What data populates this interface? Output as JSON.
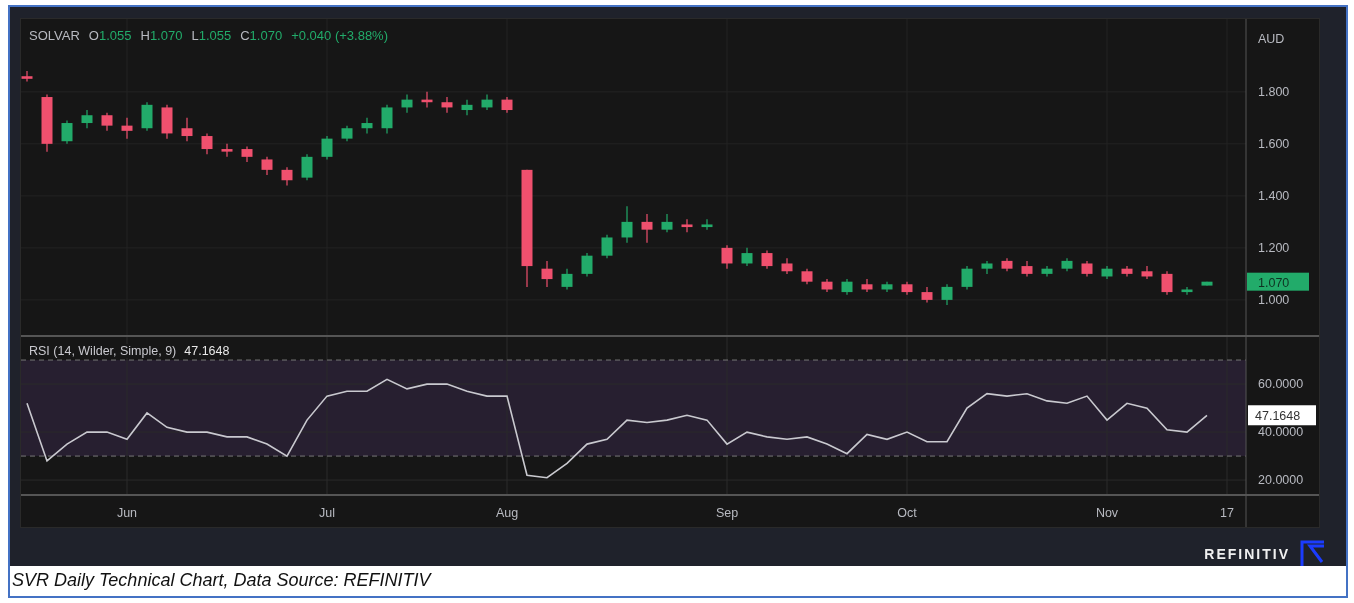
{
  "legend": {
    "symbol": "SOLVAR",
    "items": [
      {
        "label": "O",
        "value": "1.055"
      },
      {
        "label": "H",
        "value": "1.070"
      },
      {
        "label": "L",
        "value": "1.055"
      },
      {
        "label": "C",
        "value": "1.070"
      }
    ],
    "change": "+0.040 (+3.88%)"
  },
  "price_pane": {
    "currency": "AUD",
    "last_price": "1.070",
    "chart_data": {
      "type": "candlestick",
      "grid": true,
      "categories": [
        null,
        null,
        null,
        null,
        null,
        null,
        null,
        null,
        null,
        null,
        null,
        null,
        null,
        null,
        null,
        null,
        null,
        null,
        null,
        null,
        null,
        null,
        null,
        null,
        null,
        null,
        null,
        null,
        null,
        null,
        null,
        null,
        null,
        null,
        null,
        null,
        null,
        null,
        null,
        null,
        null,
        null,
        null,
        null,
        null,
        null,
        null,
        null,
        null,
        null,
        null,
        null,
        null,
        null,
        null,
        null,
        null,
        null,
        null,
        null,
        null
      ],
      "ohlc": [
        [
          1.86,
          1.88,
          1.84,
          1.85
        ],
        [
          1.78,
          1.79,
          1.57,
          1.6
        ],
        [
          1.61,
          1.69,
          1.6,
          1.68
        ],
        [
          1.68,
          1.73,
          1.66,
          1.71
        ],
        [
          1.71,
          1.72,
          1.65,
          1.67
        ],
        [
          1.67,
          1.7,
          1.62,
          1.65
        ],
        [
          1.66,
          1.76,
          1.65,
          1.75
        ],
        [
          1.74,
          1.75,
          1.62,
          1.64
        ],
        [
          1.66,
          1.7,
          1.61,
          1.63
        ],
        [
          1.63,
          1.64,
          1.56,
          1.58
        ],
        [
          1.58,
          1.6,
          1.55,
          1.57
        ],
        [
          1.58,
          1.59,
          1.53,
          1.55
        ],
        [
          1.54,
          1.55,
          1.48,
          1.5
        ],
        [
          1.5,
          1.51,
          1.44,
          1.46
        ],
        [
          1.47,
          1.56,
          1.46,
          1.55
        ],
        [
          1.55,
          1.63,
          1.54,
          1.62
        ],
        [
          1.62,
          1.67,
          1.61,
          1.66
        ],
        [
          1.66,
          1.7,
          1.64,
          1.68
        ],
        [
          1.66,
          1.75,
          1.64,
          1.74
        ],
        [
          1.74,
          1.79,
          1.72,
          1.77
        ],
        [
          1.77,
          1.8,
          1.74,
          1.76
        ],
        [
          1.76,
          1.78,
          1.72,
          1.74
        ],
        [
          1.73,
          1.77,
          1.71,
          1.75
        ],
        [
          1.74,
          1.79,
          1.73,
          1.77
        ],
        [
          1.77,
          1.78,
          1.72,
          1.73
        ],
        [
          1.5,
          1.5,
          1.05,
          1.13
        ],
        [
          1.12,
          1.15,
          1.05,
          1.08
        ],
        [
          1.05,
          1.12,
          1.04,
          1.1
        ],
        [
          1.1,
          1.18,
          1.09,
          1.17
        ],
        [
          1.17,
          1.25,
          1.16,
          1.24
        ],
        [
          1.24,
          1.36,
          1.22,
          1.3
        ],
        [
          1.3,
          1.33,
          1.22,
          1.27
        ],
        [
          1.27,
          1.33,
          1.26,
          1.3
        ],
        [
          1.29,
          1.31,
          1.26,
          1.28
        ],
        [
          1.28,
          1.31,
          1.27,
          1.29
        ],
        [
          1.2,
          1.21,
          1.12,
          1.14
        ],
        [
          1.14,
          1.2,
          1.13,
          1.18
        ],
        [
          1.18,
          1.19,
          1.12,
          1.13
        ],
        [
          1.14,
          1.16,
          1.1,
          1.11
        ],
        [
          1.11,
          1.12,
          1.06,
          1.07
        ],
        [
          1.07,
          1.08,
          1.03,
          1.04
        ],
        [
          1.03,
          1.08,
          1.02,
          1.07
        ],
        [
          1.06,
          1.08,
          1.03,
          1.04
        ],
        [
          1.04,
          1.07,
          1.03,
          1.06
        ],
        [
          1.06,
          1.07,
          1.02,
          1.03
        ],
        [
          1.03,
          1.05,
          0.99,
          1.0
        ],
        [
          1.0,
          1.06,
          0.98,
          1.05
        ],
        [
          1.05,
          1.13,
          1.04,
          1.12
        ],
        [
          1.12,
          1.15,
          1.1,
          1.14
        ],
        [
          1.15,
          1.16,
          1.11,
          1.12
        ],
        [
          1.13,
          1.15,
          1.09,
          1.1
        ],
        [
          1.1,
          1.13,
          1.09,
          1.12
        ],
        [
          1.12,
          1.16,
          1.11,
          1.15
        ],
        [
          1.14,
          1.15,
          1.09,
          1.1
        ],
        [
          1.09,
          1.13,
          1.08,
          1.12
        ],
        [
          1.12,
          1.13,
          1.09,
          1.1
        ],
        [
          1.11,
          1.13,
          1.08,
          1.09
        ],
        [
          1.1,
          1.11,
          1.02,
          1.03
        ],
        [
          1.03,
          1.05,
          1.02,
          1.04
        ],
        [
          1.055,
          1.07,
          1.055,
          1.07
        ],
        null
      ],
      "ylim": [
        0.865,
        2.08
      ],
      "yticks": [
        {
          "value": 1.0,
          "label": "1.000"
        },
        {
          "value": 1.2,
          "label": "1.200"
        },
        {
          "value": 1.4,
          "label": "1.400"
        },
        {
          "value": 1.6,
          "label": "1.600"
        },
        {
          "value": 1.8,
          "label": "1.800"
        }
      ]
    }
  },
  "rsi_pane": {
    "title": "RSI (14, Wilder, Simple, 9)",
    "value": "47.1648",
    "last_value": "47.1648",
    "chart_data": {
      "type": "line",
      "grid": true,
      "categories": [
        null,
        null,
        null,
        null,
        null,
        "Jun",
        null,
        null,
        null,
        null,
        null,
        null,
        null,
        null,
        null,
        "Jul",
        null,
        null,
        null,
        null,
        null,
        null,
        null,
        null,
        "Aug",
        null,
        null,
        null,
        null,
        null,
        null,
        null,
        null,
        null,
        null,
        "Sep",
        null,
        null,
        null,
        null,
        null,
        null,
        null,
        null,
        "Oct",
        null,
        null,
        null,
        null,
        null,
        null,
        null,
        null,
        null,
        "Nov",
        null,
        null,
        null,
        null,
        null,
        "17"
      ],
      "series": [
        {
          "color": "#c9c9cf",
          "values": [
            52,
            28,
            35,
            40,
            40,
            37,
            48,
            42,
            40,
            40,
            38,
            38,
            35,
            30,
            45,
            55,
            57,
            57,
            62,
            58,
            60,
            60,
            57,
            55,
            55,
            22,
            21,
            27,
            35,
            37,
            45,
            44,
            45,
            47,
            45,
            35,
            40,
            38,
            37,
            38,
            35,
            31,
            39,
            37,
            40,
            36,
            36,
            50,
            56,
            55,
            56,
            53,
            52,
            55,
            45,
            52,
            50,
            41,
            40,
            47,
            null
          ]
        }
      ],
      "ylim": [
        14.2,
        79.6
      ],
      "yticks": [
        {
          "value": 20,
          "label": "20.0000"
        },
        {
          "value": 40,
          "label": "40.0000"
        },
        {
          "value": 60,
          "label": "60.0000"
        }
      ],
      "ref_lines": [
        {
          "axis": "y",
          "value": 70
        },
        {
          "axis": "y",
          "value": 30
        }
      ]
    }
  },
  "brand": "REFINITIV",
  "caption": "SVR Daily Technical Chart, Data Source: REFINITIV"
}
